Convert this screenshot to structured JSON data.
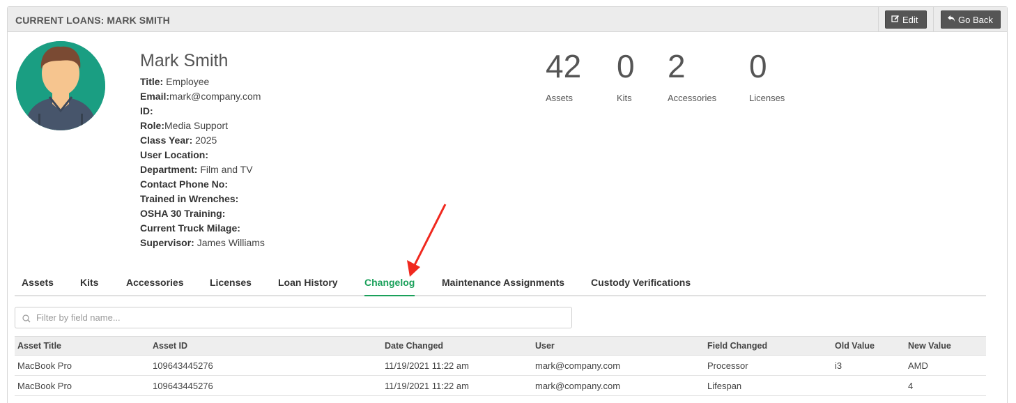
{
  "header": {
    "title": "CURRENT LOANS: MARK SMITH",
    "edit_label": "Edit",
    "back_label": "Go Back"
  },
  "profile": {
    "name": "Mark Smith",
    "fields": [
      {
        "label": "Title:",
        "value": " Employee"
      },
      {
        "label": "Email:",
        "value": "mark@company.com"
      },
      {
        "label": "ID:",
        "value": ""
      },
      {
        "label": "Role:",
        "value": "Media Support"
      },
      {
        "label": "Class Year:",
        "value": " 2025"
      },
      {
        "label": "User Location:",
        "value": ""
      },
      {
        "label": "Department:",
        "value": " Film and TV"
      },
      {
        "label": "Contact Phone No:",
        "value": ""
      },
      {
        "label": "Trained in Wrenches:",
        "value": ""
      },
      {
        "label": "OSHA 30 Training:",
        "value": ""
      },
      {
        "label": "Current Truck Milage:",
        "value": ""
      },
      {
        "label": "Supervisor:",
        "value": " James Williams"
      }
    ]
  },
  "stats": [
    {
      "value": "42",
      "label": "Assets"
    },
    {
      "value": "0",
      "label": "Kits"
    },
    {
      "value": "2",
      "label": "Accessories"
    },
    {
      "value": "0",
      "label": "Licenses"
    }
  ],
  "tabs": [
    {
      "label": "Assets"
    },
    {
      "label": "Kits"
    },
    {
      "label": "Accessories"
    },
    {
      "label": "Licenses"
    },
    {
      "label": "Loan History"
    },
    {
      "label": "Changelog",
      "active": true
    },
    {
      "label": "Maintenance Assignments"
    },
    {
      "label": "Custody Verifications"
    }
  ],
  "filter": {
    "placeholder": "Filter by field name...",
    "value": ""
  },
  "table": {
    "columns": [
      "Asset Title",
      "Asset ID",
      "Date Changed",
      "User",
      "Field Changed",
      "Old Value",
      "New Value"
    ],
    "rows": [
      [
        "MacBook Pro",
        "109643445276",
        "11/19/2021 11:22 am",
        "mark@company.com",
        "Processor",
        "i3",
        "AMD"
      ],
      [
        "MacBook Pro",
        "109643445276",
        "11/19/2021 11:22 am",
        "mark@company.com",
        "Lifespan",
        "",
        "4"
      ]
    ]
  },
  "colors": {
    "accent": "#1aa05a",
    "avatar_bg": "#1a9e82",
    "annotation_arrow": "#f0281e"
  },
  "icons": {
    "edit": "edit-icon",
    "back": "reply-arrow-icon",
    "search": "search-icon",
    "avatar": "user-avatar"
  }
}
